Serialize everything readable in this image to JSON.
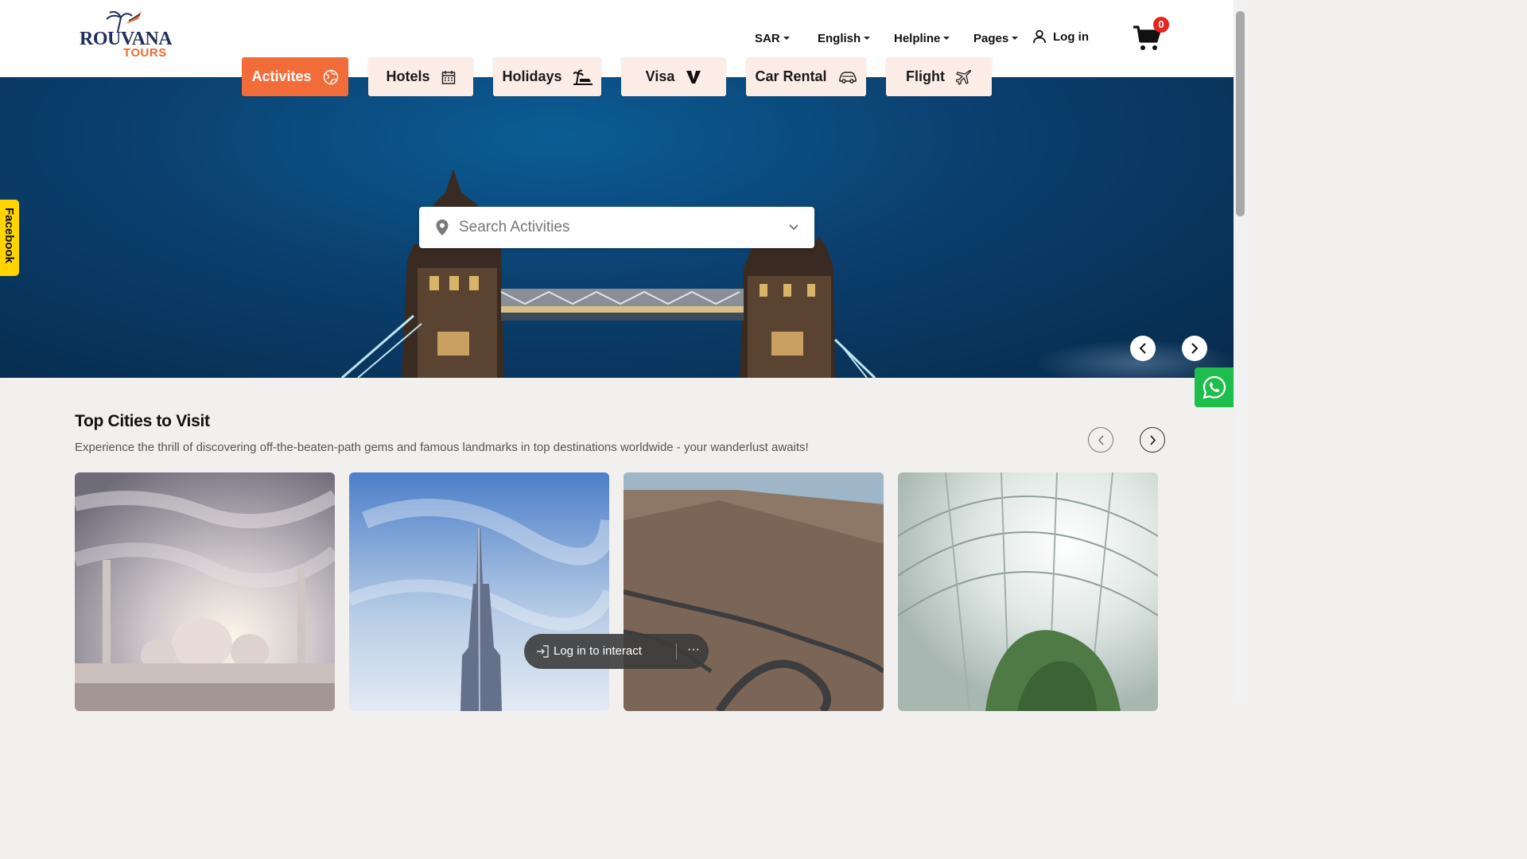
{
  "brand": {
    "line1": "ROUVANA",
    "line2": "TOURS"
  },
  "topnav": {
    "currency": "SAR",
    "language": "English",
    "helpline": "Helpline",
    "pages": "Pages",
    "login": "Log in",
    "cart_count": "0"
  },
  "tabs": [
    {
      "label": "Activites",
      "icon": "globe-icon",
      "active": true
    },
    {
      "label": "Hotels",
      "icon": "calendar-icon",
      "active": false
    },
    {
      "label": "Holidays",
      "icon": "beach-icon",
      "active": false
    },
    {
      "label": "Visa",
      "icon": "visa-icon",
      "active": false
    },
    {
      "label": "Car Rental",
      "icon": "car-icon",
      "active": false
    },
    {
      "label": "Flight",
      "icon": "plane-icon",
      "active": false
    }
  ],
  "search": {
    "placeholder": "Search Activities"
  },
  "side": {
    "facebook": "Facebook"
  },
  "section": {
    "title": "Top Cities to Visit",
    "subtitle": "Experience the thrill of discovering off-the-beaten-path gems and famous landmarks in top destinations worldwide - your wanderlust awaits!"
  },
  "overlay": {
    "login_to_interact": "Log in to interact",
    "more": "···"
  },
  "colors": {
    "accent": "#f26c3a",
    "tab_bg": "#fbece6",
    "hero": "#0b3f6e",
    "whatsapp": "#1fbe4c",
    "badge": "#e5261f"
  }
}
